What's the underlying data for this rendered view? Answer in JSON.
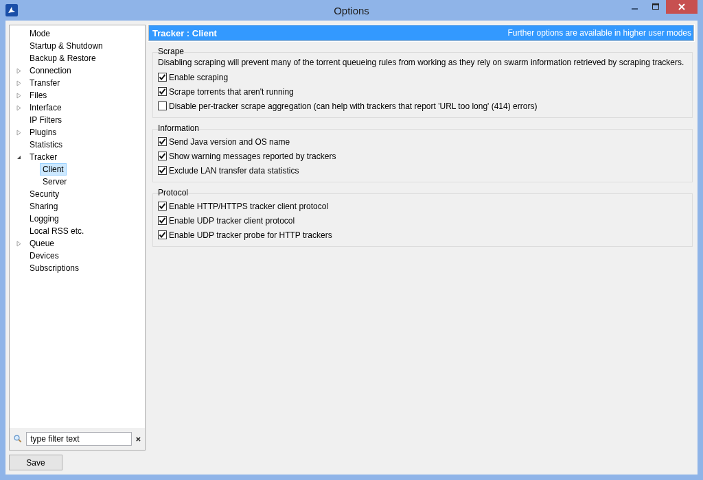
{
  "window": {
    "title": "Options"
  },
  "tree": [
    {
      "label": "Mode",
      "kind": "leaf",
      "selected": false
    },
    {
      "label": "Startup & Shutdown",
      "kind": "leaf",
      "selected": false
    },
    {
      "label": "Backup & Restore",
      "kind": "leaf",
      "selected": false
    },
    {
      "label": "Connection",
      "kind": "group",
      "expanded": false,
      "selected": false
    },
    {
      "label": "Transfer",
      "kind": "group",
      "expanded": false,
      "selected": false
    },
    {
      "label": "Files",
      "kind": "group",
      "expanded": false,
      "selected": false
    },
    {
      "label": "Interface",
      "kind": "group",
      "expanded": false,
      "selected": false
    },
    {
      "label": "IP Filters",
      "kind": "leaf",
      "selected": false
    },
    {
      "label": "Plugins",
      "kind": "group",
      "expanded": false,
      "selected": false
    },
    {
      "label": "Statistics",
      "kind": "leaf",
      "selected": false
    },
    {
      "label": "Tracker",
      "kind": "group",
      "expanded": true,
      "selected": false,
      "children": [
        {
          "label": "Client",
          "selected": true
        },
        {
          "label": "Server",
          "selected": false
        }
      ]
    },
    {
      "label": "Security",
      "kind": "leaf",
      "selected": false
    },
    {
      "label": "Sharing",
      "kind": "leaf",
      "selected": false
    },
    {
      "label": "Logging",
      "kind": "leaf",
      "selected": false
    },
    {
      "label": "Local RSS etc.",
      "kind": "leaf",
      "selected": false
    },
    {
      "label": "Queue",
      "kind": "group",
      "expanded": false,
      "selected": false
    },
    {
      "label": "Devices",
      "kind": "leaf",
      "selected": false
    },
    {
      "label": "Subscriptions",
      "kind": "leaf",
      "selected": false
    }
  ],
  "filter": {
    "value": "type filter text"
  },
  "save_button": "Save",
  "header": {
    "title": "Tracker : Client",
    "note": "Further options are available in higher user modes"
  },
  "sections": [
    {
      "title": "Scrape",
      "description": "Disabling scraping will prevent many of the torrent queueing rules from working as they rely on swarm information retrieved by scraping trackers.",
      "options": [
        {
          "label": "Enable scraping",
          "checked": true
        },
        {
          "label": "Scrape torrents that aren't running",
          "checked": true
        },
        {
          "label": "Disable per-tracker scrape aggregation (can help with trackers that report 'URL too long' (414) errors)",
          "checked": false
        }
      ]
    },
    {
      "title": "Information",
      "options": [
        {
          "label": "Send Java version and OS name",
          "checked": true
        },
        {
          "label": "Show warning messages reported by trackers",
          "checked": true
        },
        {
          "label": "Exclude LAN transfer data statistics",
          "checked": true
        }
      ]
    },
    {
      "title": "Protocol",
      "options": [
        {
          "label": "Enable HTTP/HTTPS tracker client protocol",
          "checked": true
        },
        {
          "label": "Enable UDP tracker client protocol",
          "checked": true
        },
        {
          "label": "Enable UDP tracker probe for HTTP trackers",
          "checked": true
        }
      ]
    }
  ]
}
